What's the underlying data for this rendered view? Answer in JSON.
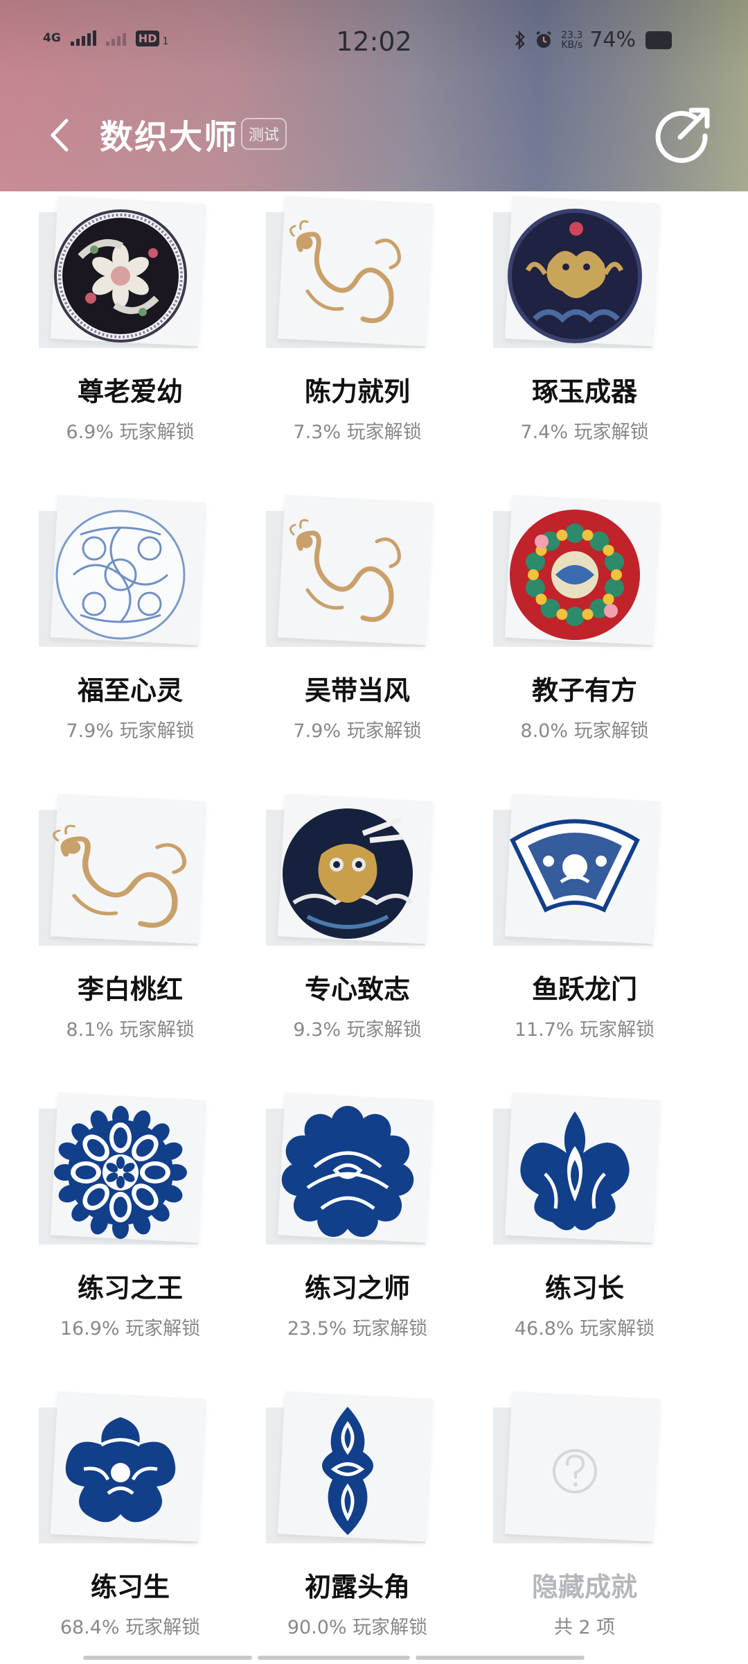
{
  "status_bar": {
    "network": "4G",
    "hd": "HD",
    "sim": "1",
    "time": "12:02",
    "speed_value": "23.3",
    "speed_unit": "KB/s",
    "battery": "74%"
  },
  "nav": {
    "title": "数织大师",
    "badge": "测试",
    "back_icon": "chevron-left-icon",
    "share_icon": "share-icon"
  },
  "achievements": [
    {
      "name": "尊老爱幼",
      "rate": "6.9% 玩家解锁",
      "art": "dark-medallion"
    },
    {
      "name": "陈力就列",
      "rate": "7.3% 玩家解锁",
      "art": "gold-dragon"
    },
    {
      "name": "琢玉成器",
      "rate": "7.4% 玩家解锁",
      "art": "navy-dragon-medallion"
    },
    {
      "name": "福至心灵",
      "rate": "7.9% 玩家解锁",
      "art": "blue-line-medallion"
    },
    {
      "name": "吴带当风",
      "rate": "7.9% 玩家解锁",
      "art": "gold-dragon"
    },
    {
      "name": "教子有方",
      "rate": "8.0% 玩家解锁",
      "art": "red-medallion"
    },
    {
      "name": "李白桃红",
      "rate": "8.1% 玩家解锁",
      "art": "gold-dragon-long"
    },
    {
      "name": "专心致志",
      "rate": "9.3% 玩家解锁",
      "art": "dark-dragon-medallion"
    },
    {
      "name": "鱼跃龙门",
      "rate": "11.7% 玩家解锁",
      "art": "blue-fan"
    },
    {
      "name": "练习之王",
      "rate": "16.9% 玩家解锁",
      "art": "blue-flower-medallion"
    },
    {
      "name": "练习之师",
      "rate": "23.5% 玩家解锁",
      "art": "blue-peony"
    },
    {
      "name": "练习长",
      "rate": "46.8% 玩家解锁",
      "art": "blue-lotus"
    },
    {
      "name": "练习生",
      "rate": "68.4% 玩家解锁",
      "art": "blue-flower"
    },
    {
      "name": "初露头角",
      "rate": "90.0% 玩家解锁",
      "art": "blue-ornament"
    },
    {
      "name": "隐藏成就",
      "rate": "共 2 项",
      "art": "question-icon"
    }
  ],
  "colors": {
    "blue": "#123f8a",
    "gold": "#c9a06a",
    "dark": "#1a1720",
    "red": "#c0232a"
  }
}
